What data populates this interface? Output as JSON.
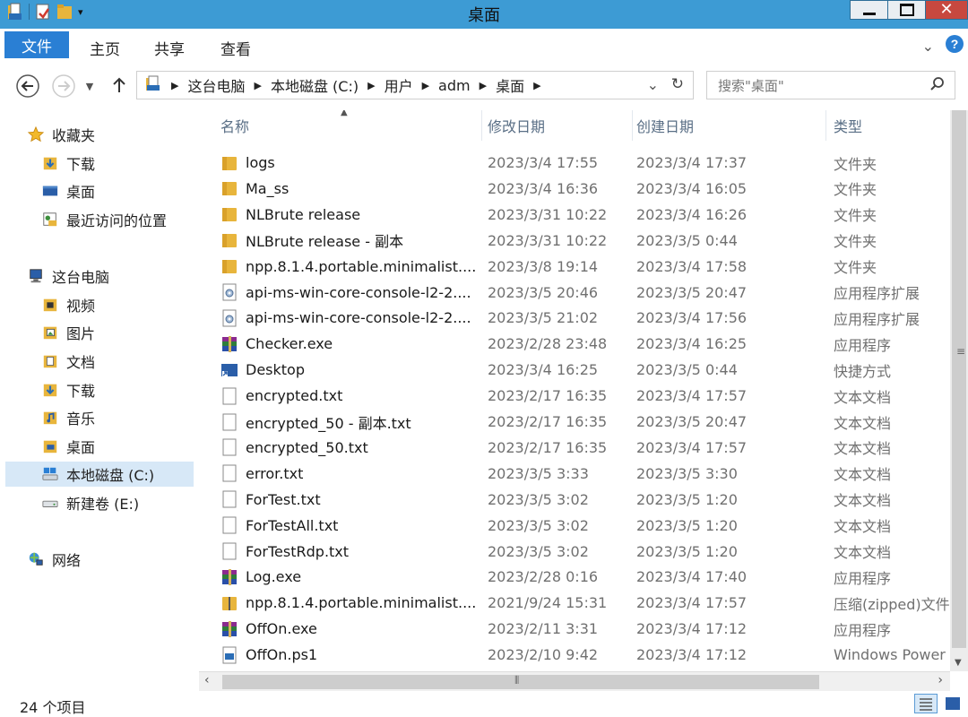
{
  "window": {
    "title": "桌面"
  },
  "ribbon": {
    "tabs": [
      "文件",
      "主页",
      "共享",
      "查看"
    ]
  },
  "address": {
    "crumbs": [
      "这台电脑",
      "本地磁盘 (C:)",
      "用户",
      "adm",
      "桌面"
    ],
    "search_placeholder": "搜索\"桌面\""
  },
  "nav": {
    "favorites": {
      "label": "收藏夹",
      "items": [
        "下载",
        "桌面",
        "最近访问的位置"
      ]
    },
    "this_pc": {
      "label": "这台电脑",
      "items": [
        "视频",
        "图片",
        "文档",
        "下载",
        "音乐",
        "桌面",
        "本地磁盘 (C:)",
        "新建卷 (E:)"
      ]
    },
    "network": {
      "label": "网络"
    }
  },
  "columns": {
    "name": "名称",
    "modified": "修改日期",
    "created": "创建日期",
    "type": "类型"
  },
  "files": [
    {
      "name": "logs",
      "modified": "2023/3/4 17:55",
      "created": "2023/3/4 17:37",
      "type": "文件夹",
      "icon": "folder-icon"
    },
    {
      "name": "Ma_ss",
      "modified": "2023/3/4 16:36",
      "created": "2023/3/4 16:05",
      "type": "文件夹",
      "icon": "folder-icon"
    },
    {
      "name": "NLBrute release",
      "modified": "2023/3/31 10:22",
      "created": "2023/3/4 16:26",
      "type": "文件夹",
      "icon": "folder-icon"
    },
    {
      "name": "NLBrute release - 副本",
      "modified": "2023/3/31 10:22",
      "created": "2023/3/5 0:44",
      "type": "文件夹",
      "icon": "folder-icon"
    },
    {
      "name": "npp.8.1.4.portable.minimalist....",
      "modified": "2023/3/8 19:14",
      "created": "2023/3/4 17:58",
      "type": "文件夹",
      "icon": "folder-icon"
    },
    {
      "name": "api-ms-win-core-console-l2-2....",
      "modified": "2023/3/5 20:46",
      "created": "2023/3/5 20:47",
      "type": "应用程序扩展",
      "icon": "dll-icon"
    },
    {
      "name": "api-ms-win-core-console-l2-2....",
      "modified": "2023/3/5 21:02",
      "created": "2023/3/4 17:56",
      "type": "应用程序扩展",
      "icon": "dll-icon"
    },
    {
      "name": "Checker.exe",
      "modified": "2023/2/28 23:48",
      "created": "2023/3/4 16:25",
      "type": "应用程序",
      "icon": "winrar-exe-icon"
    },
    {
      "name": "Desktop",
      "modified": "2023/3/4 16:25",
      "created": "2023/3/5 0:44",
      "type": "快捷方式",
      "icon": "shortcut-icon"
    },
    {
      "name": "encrypted.txt",
      "modified": "2023/2/17 16:35",
      "created": "2023/3/4 17:57",
      "type": "文本文档",
      "icon": "text-file-icon"
    },
    {
      "name": "encrypted_50 - 副本.txt",
      "modified": "2023/2/17 16:35",
      "created": "2023/3/5 20:47",
      "type": "文本文档",
      "icon": "text-file-icon"
    },
    {
      "name": "encrypted_50.txt",
      "modified": "2023/2/17 16:35",
      "created": "2023/3/4 17:57",
      "type": "文本文档",
      "icon": "text-file-icon"
    },
    {
      "name": "error.txt",
      "modified": "2023/3/5 3:33",
      "created": "2023/3/5 3:30",
      "type": "文本文档",
      "icon": "text-file-icon"
    },
    {
      "name": "ForTest.txt",
      "modified": "2023/3/5 3:02",
      "created": "2023/3/5 1:20",
      "type": "文本文档",
      "icon": "text-file-icon"
    },
    {
      "name": "ForTestAll.txt",
      "modified": "2023/3/5 3:02",
      "created": "2023/3/5 1:20",
      "type": "文本文档",
      "icon": "text-file-icon"
    },
    {
      "name": "ForTestRdp.txt",
      "modified": "2023/3/5 3:02",
      "created": "2023/3/5 1:20",
      "type": "文本文档",
      "icon": "text-file-icon"
    },
    {
      "name": "Log.exe",
      "modified": "2023/2/28 0:16",
      "created": "2023/3/4 17:40",
      "type": "应用程序",
      "icon": "winrar-exe-icon"
    },
    {
      "name": "npp.8.1.4.portable.minimalist....",
      "modified": "2021/9/24 15:31",
      "created": "2023/3/4 17:57",
      "type": "压缩(zipped)文件",
      "icon": "zip-folder-icon"
    },
    {
      "name": "OffOn.exe",
      "modified": "2023/2/11 3:31",
      "created": "2023/3/4 17:12",
      "type": "应用程序",
      "icon": "winrar-exe-icon"
    },
    {
      "name": "OffOn.ps1",
      "modified": "2023/2/10 9:42",
      "created": "2023/3/4 17:12",
      "type": "Windows Power",
      "icon": "powershell-script-icon"
    }
  ],
  "status": {
    "count": "24 个项目"
  },
  "colors": {
    "titlebar": "#3d9bd4",
    "file_tab": "#2a7fd4",
    "selection": "#d7e8f7",
    "folder": "#e8b53c"
  }
}
